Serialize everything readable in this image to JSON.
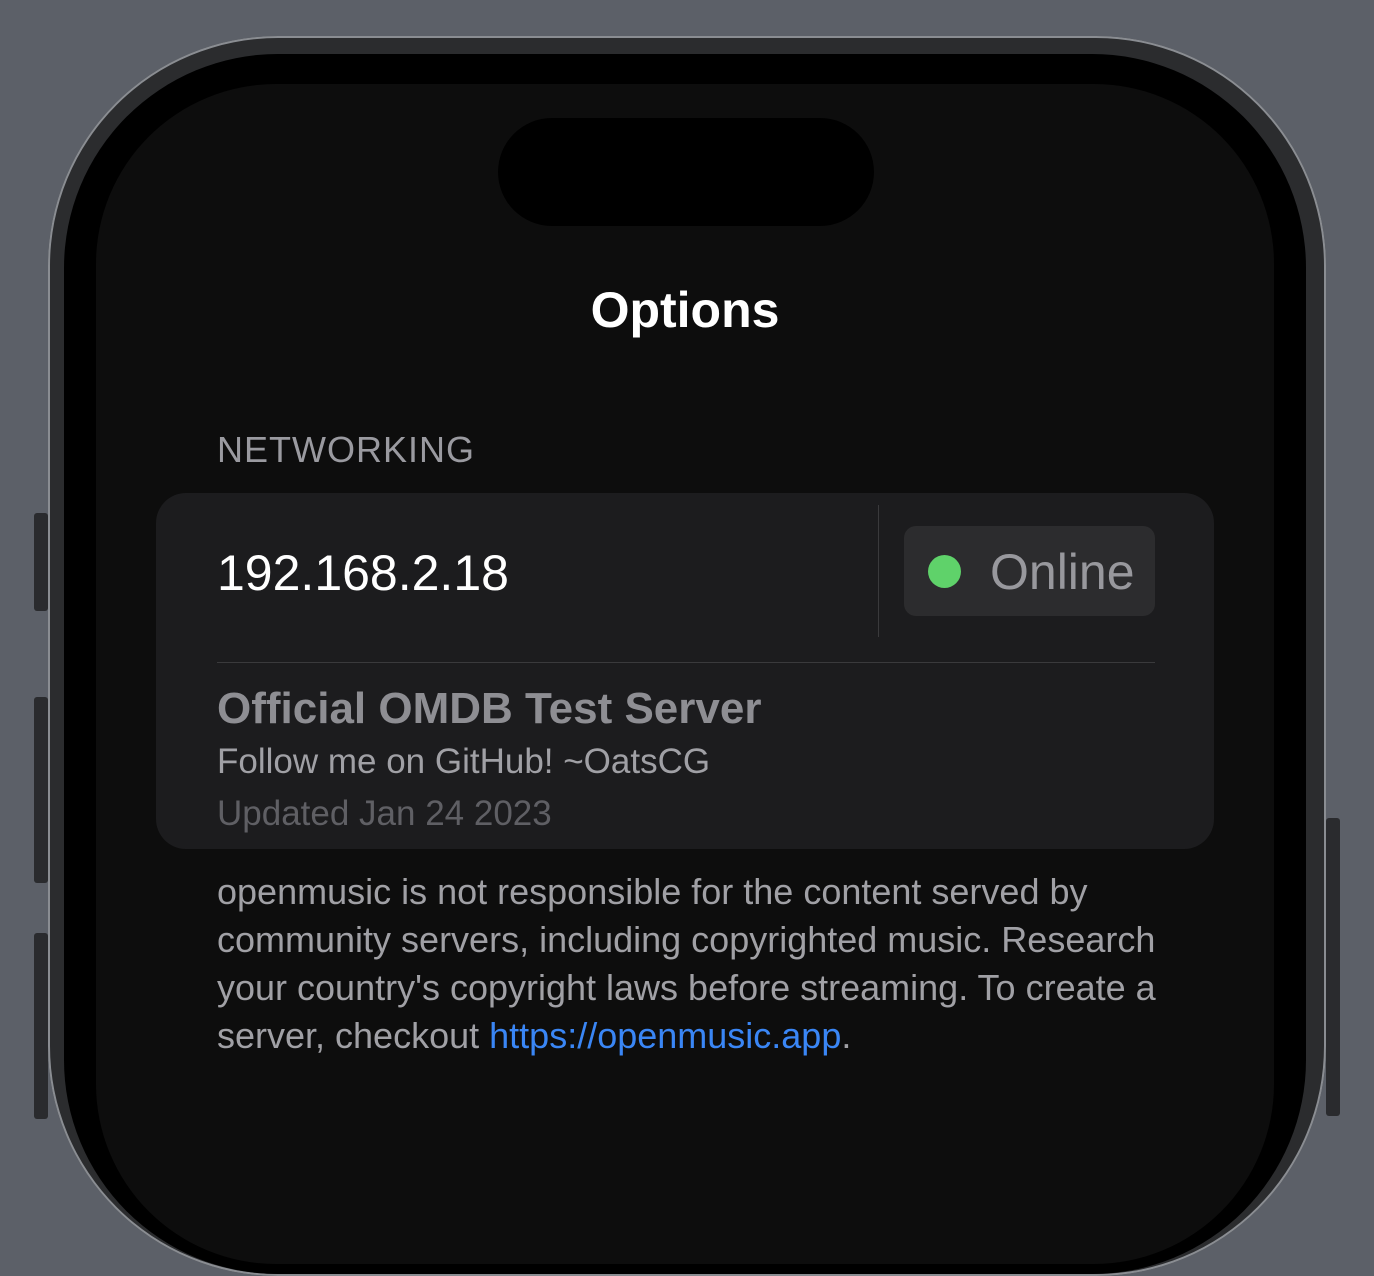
{
  "title": "Options",
  "networking": {
    "header": "NETWORKING",
    "ip_address": "192.168.2.18",
    "status": {
      "label": "Online",
      "dot_color": "#5fd26a"
    },
    "server": {
      "name": "Official OMDB Test Server",
      "description": "Follow me on GitHub! ~OatsCG",
      "updated": "Updated Jan 24 2023"
    }
  },
  "footer": {
    "text": "openmusic is not responsible for the content served by community servers, including copyrighted music. Research your country's copyright laws before streaming. To create a server, checkout ",
    "link_text": "https://openmusic.app",
    "suffix": "."
  },
  "colors": {
    "background": "#0d0d0d",
    "card": "#1c1c1e",
    "link": "#3a86f5"
  }
}
